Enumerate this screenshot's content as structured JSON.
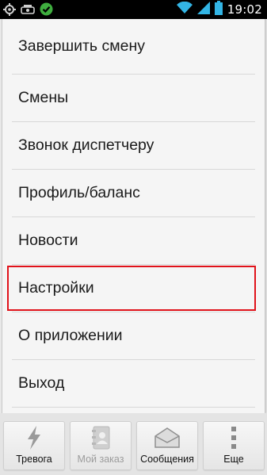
{
  "status_bar": {
    "time": "19:02",
    "left_icons": [
      "gps-icon",
      "notification-icon",
      "check-circle-icon"
    ],
    "right_icons": [
      "wifi-icon",
      "signal-icon",
      "battery-icon"
    ]
  },
  "menu": {
    "items": [
      {
        "label": "Завершить смену"
      },
      {
        "label": "Смены"
      },
      {
        "label": "Звонок диспетчеру"
      },
      {
        "label": "Профиль/баланс"
      },
      {
        "label": "Новости"
      },
      {
        "label": "Настройки"
      },
      {
        "label": "О приложении"
      },
      {
        "label": "Выход"
      }
    ],
    "selected_index": 5
  },
  "bottom_tabs": [
    {
      "label": "Тревога",
      "icon": "lightning-icon",
      "enabled": true
    },
    {
      "label": "Мой заказ",
      "icon": "contacts-book-icon",
      "enabled": false
    },
    {
      "label": "Сообщения",
      "icon": "envelope-icon",
      "enabled": true
    },
    {
      "label": "Еще",
      "icon": "more-vertical-icon",
      "enabled": true
    }
  ],
  "colors": {
    "highlight_border": "#e0121a",
    "status_bar_bg": "#000000"
  }
}
